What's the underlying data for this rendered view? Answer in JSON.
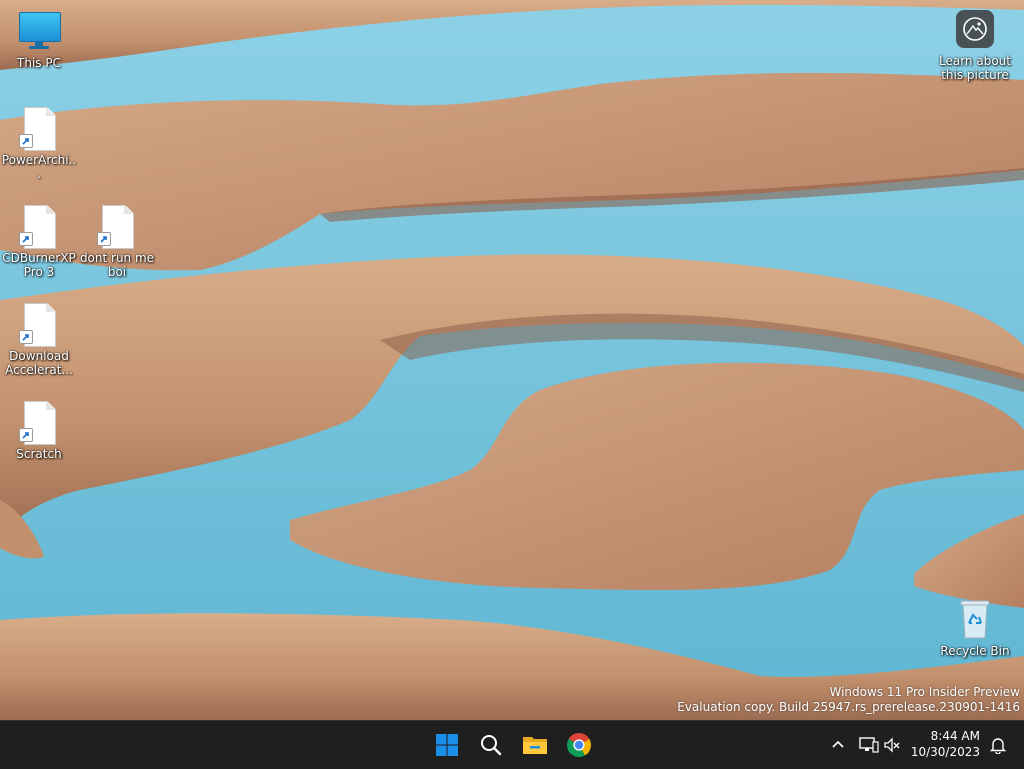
{
  "desktop": {
    "icons": [
      {
        "label": "This PC",
        "type": "this-pc"
      },
      {
        "label": "PowerArchi...",
        "type": "shortcut"
      },
      {
        "label": "CDBurnerXP Pro 3",
        "type": "shortcut"
      },
      {
        "label": "dont run me boi",
        "type": "shortcut"
      },
      {
        "label": "Download Accelerat...",
        "type": "shortcut"
      },
      {
        "label": "Scratch",
        "type": "shortcut"
      },
      {
        "label": "Recycle Bin",
        "type": "recycle-bin"
      }
    ],
    "learn_about": "Learn about this picture",
    "watermark": {
      "line1": "Windows 11 Pro Insider Preview",
      "line2": "Evaluation copy. Build 25947.rs_prerelease.230901-1416"
    }
  },
  "taskbar": {
    "apps": [
      {
        "name": "start-button",
        "icon": "windows-logo-icon"
      },
      {
        "name": "search-button",
        "icon": "search-icon"
      },
      {
        "name": "file-explorer-button",
        "icon": "folder-icon"
      },
      {
        "name": "chrome-button",
        "icon": "chrome-icon"
      }
    ],
    "tray": {
      "time": "8:44 AM",
      "date": "10/30/2023",
      "icons": [
        "chevron-up-icon",
        "network-icon",
        "volume-muted-icon",
        "notification-bell-icon"
      ]
    }
  },
  "colors": {
    "water": "#6fc0d8",
    "sand": "#c99a78",
    "taskbar": "#1f1f1f",
    "windows_blue": "#1b8ee8"
  }
}
